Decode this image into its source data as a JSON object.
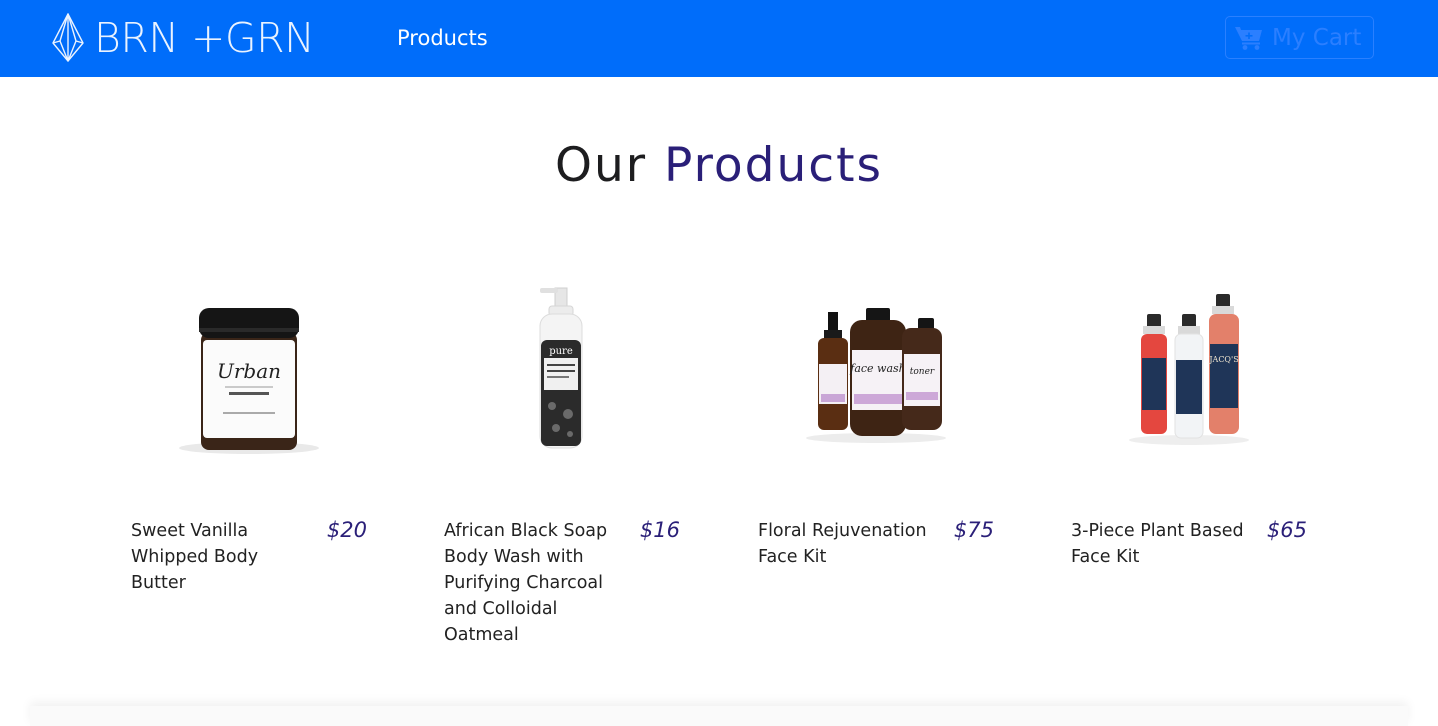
{
  "navbar": {
    "brand_text": "BRN +GRN",
    "products_link": "Products",
    "cart_label": "My Cart",
    "colors": {
      "background": "#006dfa",
      "cart_accent": "#2b7fff"
    }
  },
  "heading": {
    "part1": "Our",
    "part2": "Products"
  },
  "products": [
    {
      "name": "Sweet Vanilla Whipped Body Butter",
      "price": "$20",
      "image_icon": "body-butter-jar"
    },
    {
      "name": "African Black Soap Body Wash with Purifying Charcoal and Colloidal Oatmeal",
      "price": "$16",
      "image_icon": "pump-bottle"
    },
    {
      "name": "Floral Rejuvenation Face Kit",
      "price": "$75",
      "image_icon": "amber-bottles-kit"
    },
    {
      "name": "3-Piece Plant Based Face Kit",
      "price": "$65",
      "image_icon": "spray-bottles-kit"
    }
  ],
  "colors": {
    "accent": "#2a1f78"
  }
}
